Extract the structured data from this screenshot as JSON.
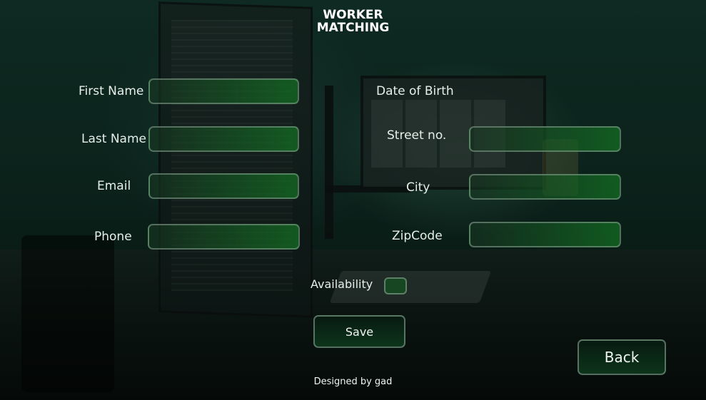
{
  "header": {
    "title_line1": "WORKER",
    "title_line2": "MATCHING"
  },
  "form": {
    "first_name": {
      "label": "First Name",
      "value": ""
    },
    "last_name": {
      "label": "Last Name",
      "value": ""
    },
    "email": {
      "label": "Email",
      "value": ""
    },
    "phone": {
      "label": "Phone",
      "value": ""
    },
    "date_of_birth": {
      "label": "Date of Birth"
    },
    "street_no": {
      "label": "Street no.",
      "value": ""
    },
    "city": {
      "label": "City",
      "value": ""
    },
    "zipcode": {
      "label": "ZipCode",
      "value": ""
    },
    "availability": {
      "label": "Availability",
      "checked": false
    }
  },
  "actions": {
    "save_label": "Save",
    "back_label": "Back"
  },
  "footer": {
    "credit": "Designed by gad"
  },
  "colors": {
    "accent_green": "#1a7a2a",
    "text": "#e6eee9"
  }
}
